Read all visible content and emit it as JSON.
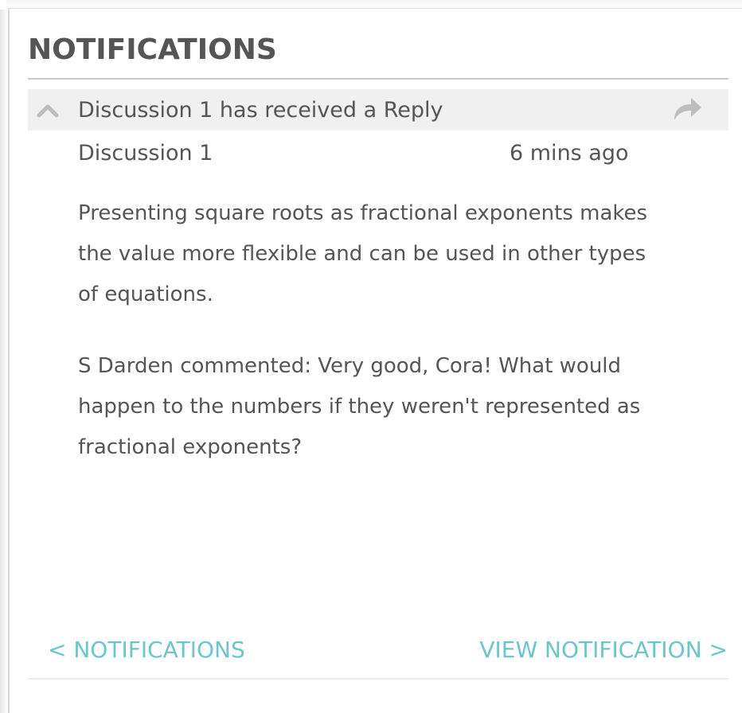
{
  "panel": {
    "title": "NOTIFICATIONS"
  },
  "notification": {
    "subject": "Discussion 1 has received a Reply",
    "source": "Discussion 1",
    "time": "6 mins ago",
    "body_paragraphs": [
      "Presenting square roots as fractional exponents makes the value more flexible and can be used in other types of equations.",
      "S Darden commented: Very good, Cora! What would happen to the numbers if they weren't represented as fractional exponents?"
    ],
    "icons": {
      "collapse": "chevron-up-icon",
      "forward": "share-forward-icon"
    }
  },
  "footer": {
    "back_label": "< NOTIFICATIONS",
    "view_label": "VIEW NOTIFICATION >"
  },
  "colors": {
    "text": "#555555",
    "link": "#6cc6c8",
    "header_bg": "#f0f0f0",
    "icon": "#bdbdbd"
  }
}
